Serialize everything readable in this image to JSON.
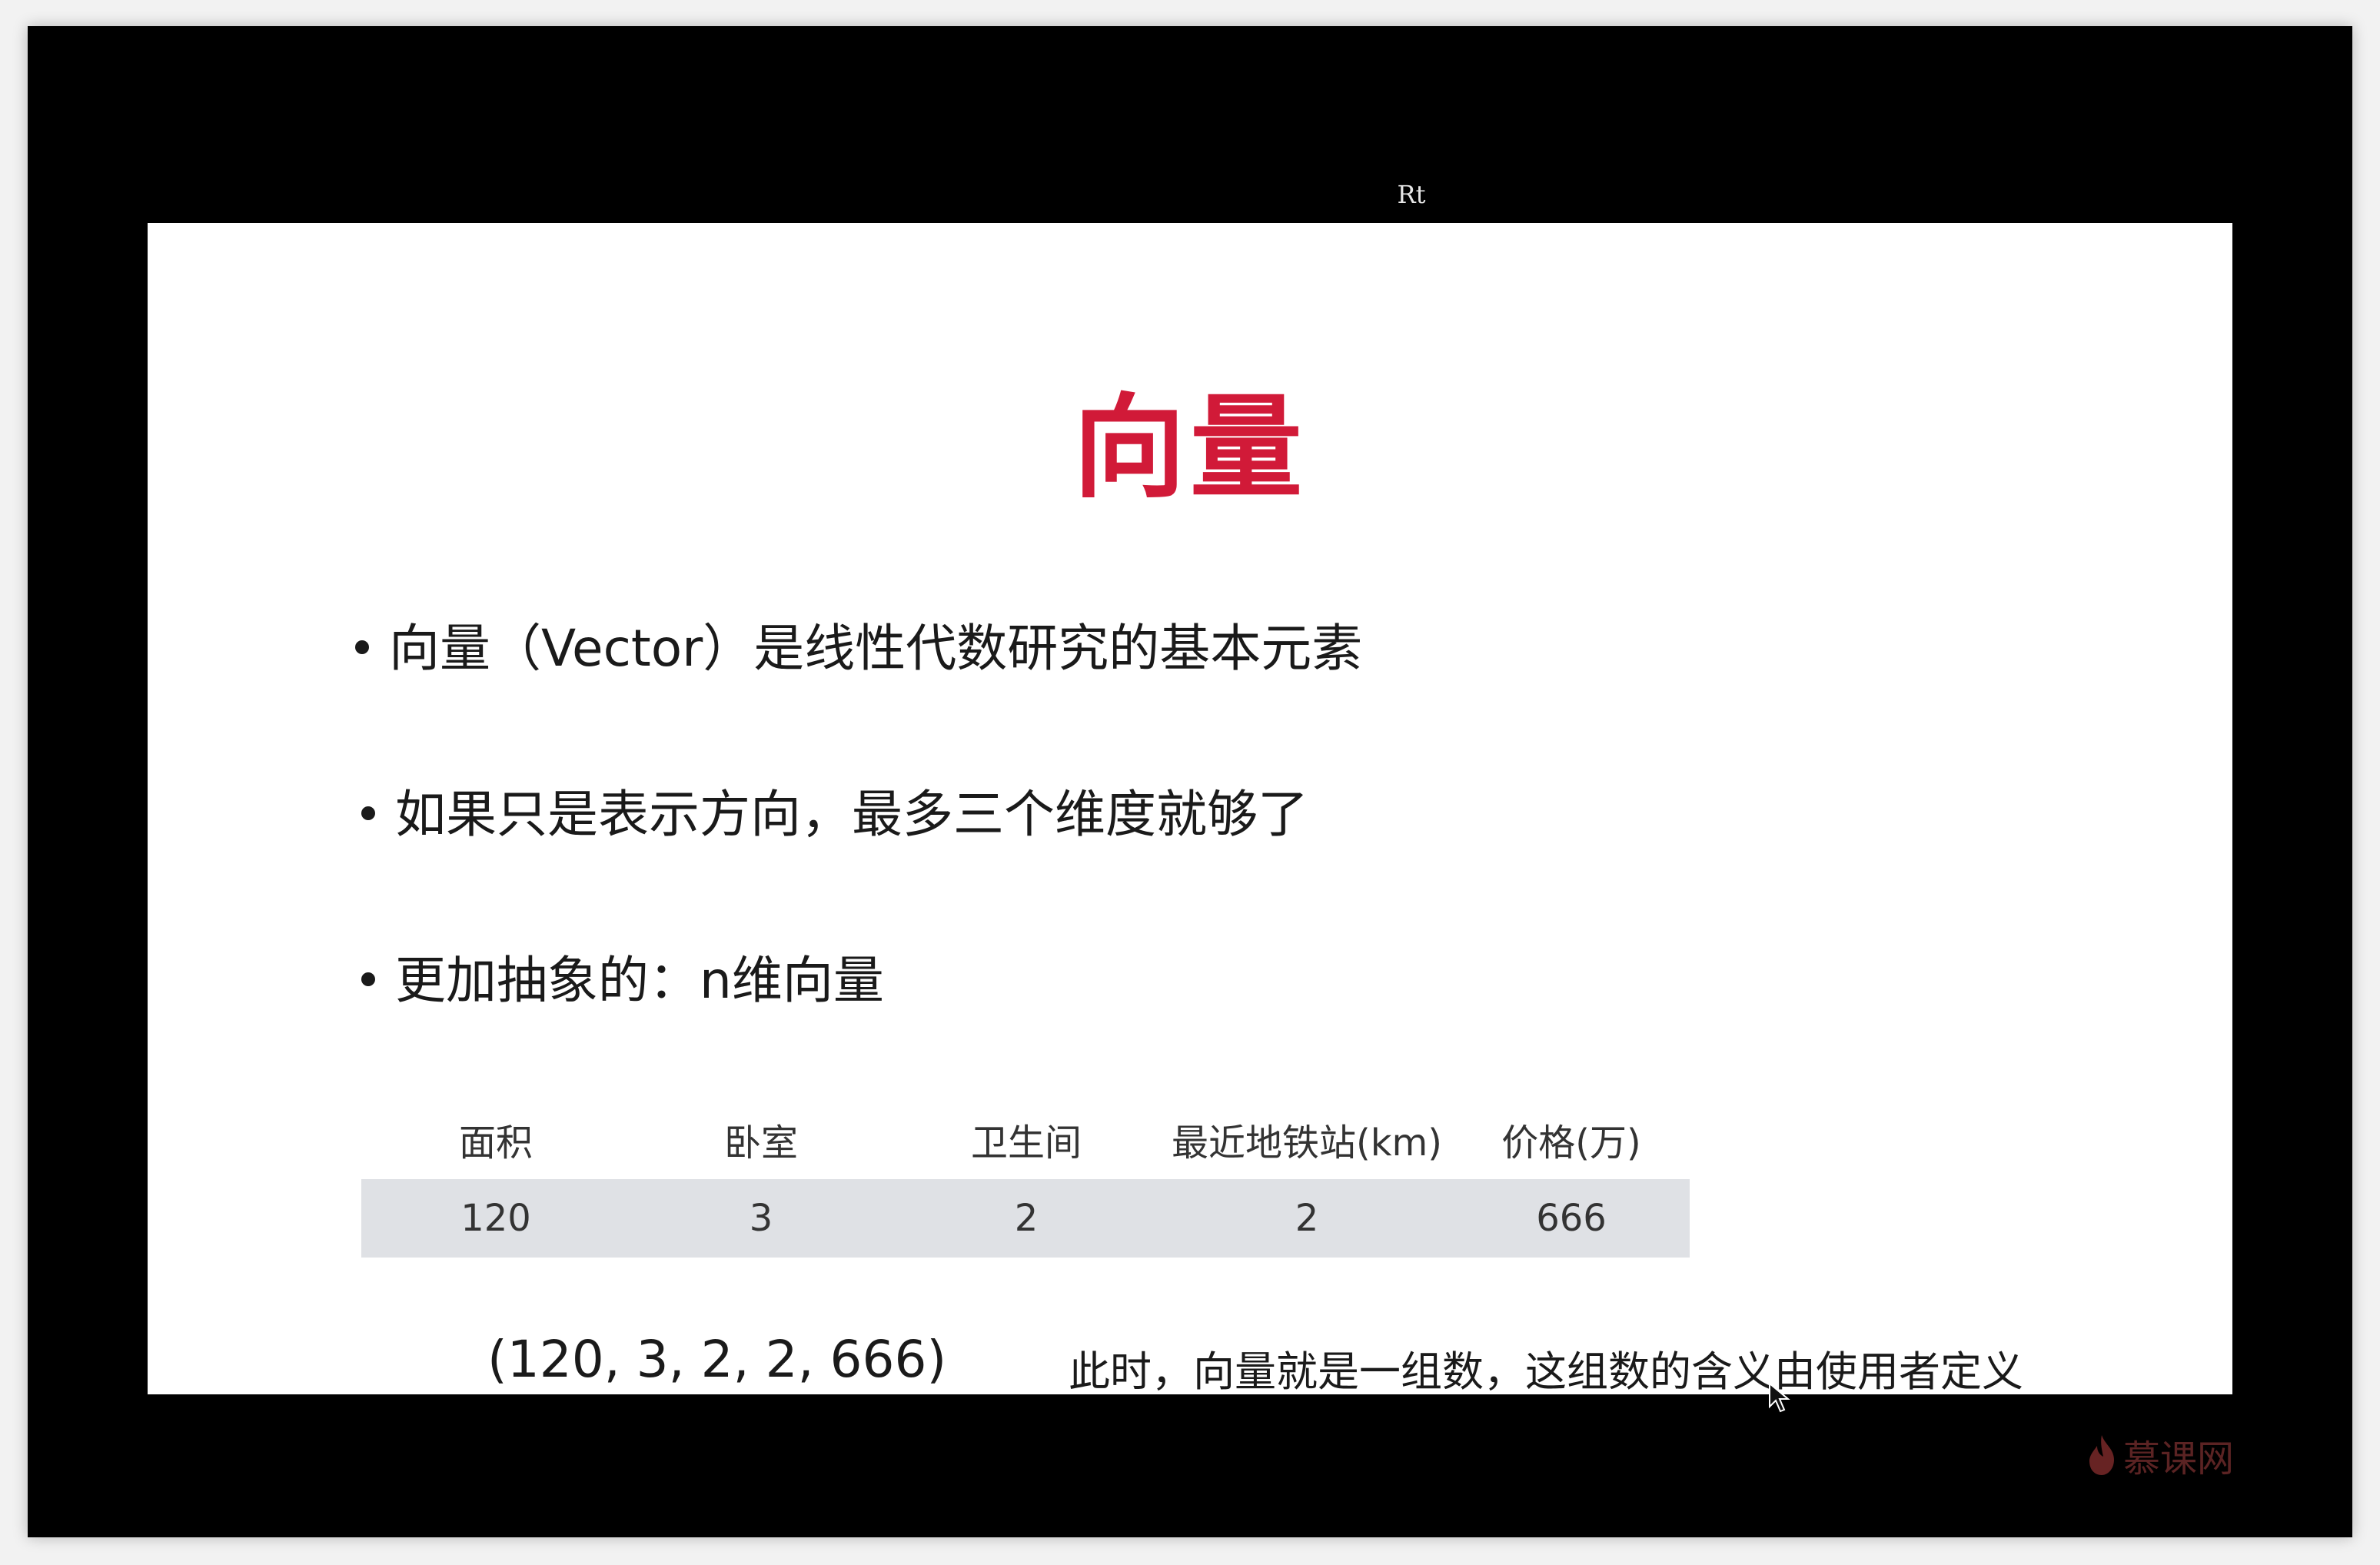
{
  "window": {
    "top_label": "Rt"
  },
  "slide": {
    "title": "向量",
    "bullets": [
      "向量（Vector）是线性代数研究的基本元素",
      "如果只是表示方向，最多三个维度就够了",
      "更加抽象的：n维向量"
    ],
    "table": {
      "headers": [
        "面积",
        "卧室",
        "卫生间",
        "最近地铁站(km)",
        "价格(万)"
      ],
      "row": [
        "120",
        "3",
        "2",
        "2",
        "666"
      ]
    },
    "vector_text": "(120, 3, 2, 2, 666)",
    "note": "此时，向量就是一组数，这组数的含义由使用者定义"
  },
  "watermark": {
    "text": "慕课网",
    "icon": "flame-icon"
  },
  "colors": {
    "title": "#d11a38",
    "table_row_bg": "#dfe1e5",
    "frame": "#000000"
  }
}
